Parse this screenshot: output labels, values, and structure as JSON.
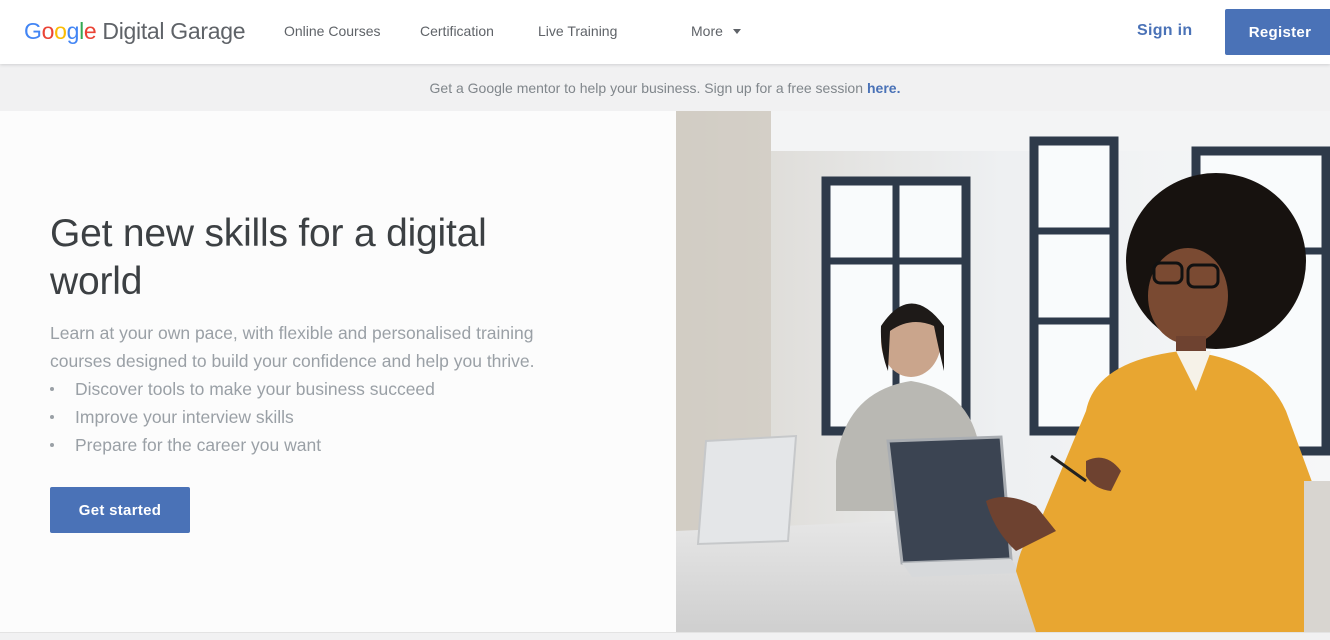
{
  "header": {
    "logo": {
      "letters": [
        "G",
        "o",
        "o",
        "g",
        "l",
        "e"
      ],
      "brand": "Digital Garage"
    },
    "nav": {
      "online_courses": "Online Courses",
      "certification": "Certification",
      "live_training": "Live Training",
      "more": "More"
    },
    "sign_in": "Sign in",
    "register": "Register"
  },
  "banner": {
    "text": "Get a Google mentor to help your business. Sign up for a free session",
    "link": "here."
  },
  "hero": {
    "title": "Get new skills for a digital world",
    "subtitle": "Learn at your own pace, with flexible and personalised training courses designed to build your confidence and help you thrive.",
    "bullets": [
      "Discover tools to make your business succeed",
      "Improve your interview skills",
      "Prepare for the career you want"
    ],
    "cta": "Get started"
  },
  "icons": {
    "more_caret": "chevron-down-icon"
  },
  "colors": {
    "accent": "#4a72b7",
    "google_blue": "#4285f4",
    "google_red": "#ea4335",
    "google_yellow": "#fbbc05",
    "google_green": "#34a853",
    "banner_bg": "#f1f1f2",
    "sweater": "#e8a631"
  }
}
